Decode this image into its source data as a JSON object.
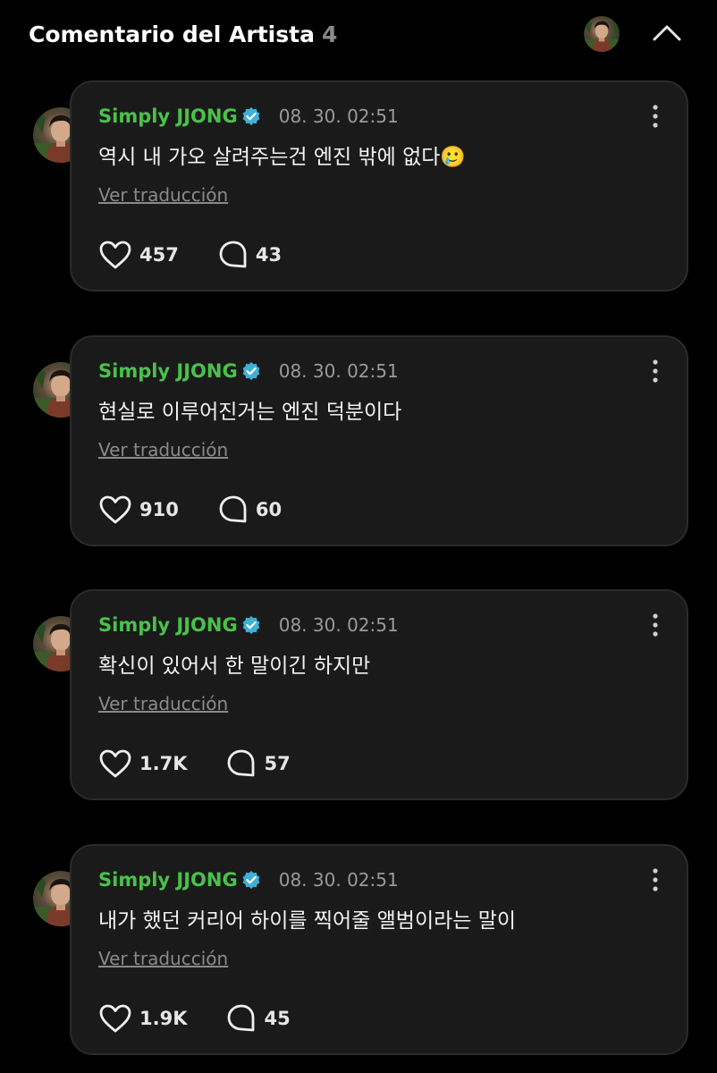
{
  "header": {
    "title": "Comentario del Artista",
    "count": "4",
    "avatar_icon": "user-avatar",
    "collapse_icon": "chevron-up-icon"
  },
  "colors": {
    "background": "#000000",
    "card": "#1a1a1a",
    "author": "#4ac14a",
    "verified": "#3fb0d6"
  },
  "comments": [
    {
      "author": "Simply JJONG",
      "time": "08. 30. 02:51",
      "text": "역시 내 가오 살려주는건 엔진 밖에 없다🥲",
      "translate": "Ver traducción",
      "likes": "457",
      "replies": "43"
    },
    {
      "author": "Simply JJONG",
      "time": "08. 30. 02:51",
      "text": "현실로 이루어진거는 엔진 덕분이다",
      "translate": "Ver traducción",
      "likes": "910",
      "replies": "60"
    },
    {
      "author": "Simply JJONG",
      "time": "08. 30. 02:51",
      "text": "확신이 있어서 한 말이긴 하지만",
      "translate": "Ver traducción",
      "likes": "1.7K",
      "replies": "57"
    },
    {
      "author": "Simply JJONG",
      "time": "08. 30. 02:51",
      "text": "내가 했던 커리어 하이를 찍어줄 앨범이라는 말이",
      "translate": "Ver traducción",
      "likes": "1.9K",
      "replies": "45"
    }
  ]
}
